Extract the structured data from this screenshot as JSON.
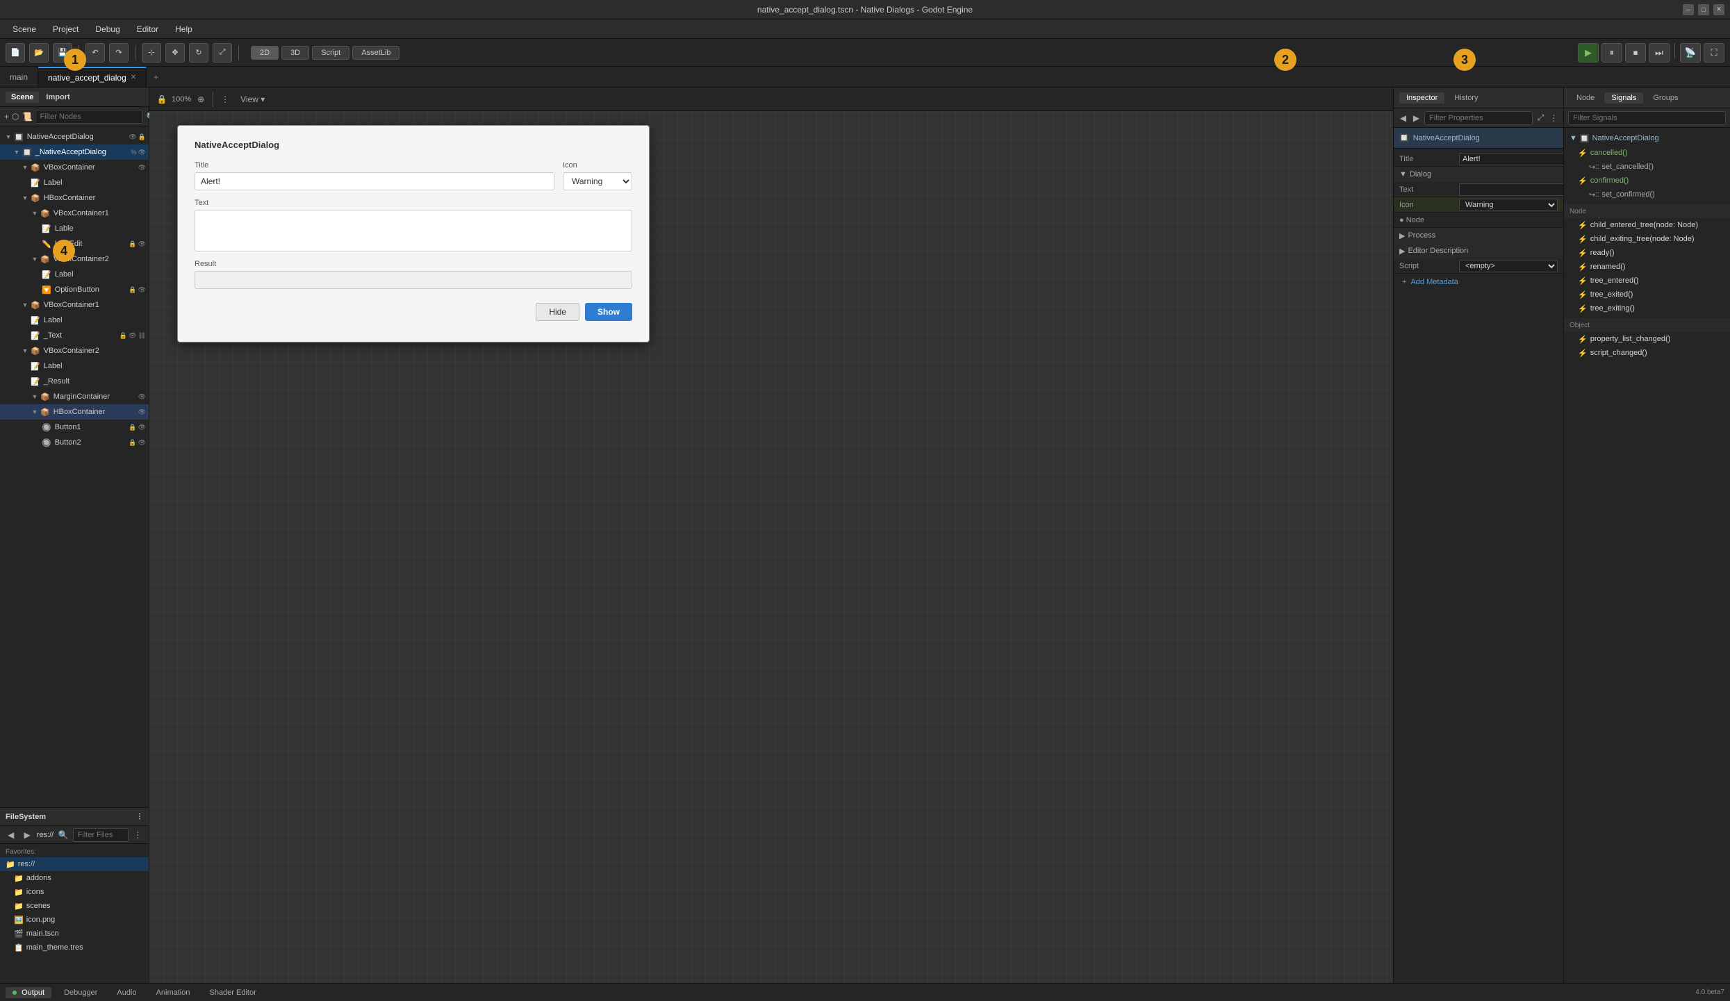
{
  "window": {
    "title": "native_accept_dialog.tscn - Native Dialogs - Godot Engine"
  },
  "menu": {
    "items": [
      "Scene",
      "Project",
      "Debug",
      "Editor",
      "Help"
    ]
  },
  "toolbar": {
    "view_modes": [
      "2D",
      "3D",
      "Script",
      "AssetLib"
    ],
    "active_view": "2D"
  },
  "tabs": {
    "items": [
      "main",
      "native_accept_dialog"
    ],
    "active": "native_accept_dialog",
    "add_label": "+"
  },
  "scene_panel": {
    "title": "Scene",
    "import_tab": "Import",
    "filter_placeholder": "Filter Nodes",
    "nodes": [
      {
        "level": 0,
        "label": "NativeAcceptDialog",
        "icon": "🔲",
        "has_children": true,
        "badges": [
          "eye",
          "lock"
        ]
      },
      {
        "level": 1,
        "label": "_NativeAcceptDialog",
        "icon": "🔲",
        "has_children": true,
        "selected": true,
        "badges": [
          "percent",
          "eye"
        ]
      },
      {
        "level": 2,
        "label": "VBoxContainer",
        "icon": "📦",
        "has_children": true,
        "badges": [
          "eye"
        ]
      },
      {
        "level": 3,
        "label": "Label",
        "icon": "📝",
        "has_children": false
      },
      {
        "level": 2,
        "label": "HBoxContainer",
        "icon": "📦",
        "has_children": true
      },
      {
        "level": 3,
        "label": "VBoxContainer1",
        "icon": "📦",
        "has_children": true
      },
      {
        "level": 4,
        "label": "Lable",
        "icon": "📝"
      },
      {
        "level": 4,
        "label": "LineEdit",
        "icon": "✏️",
        "badges": [
          "lock",
          "eye"
        ]
      },
      {
        "level": 3,
        "label": "VBoxContainer2",
        "icon": "📦",
        "has_children": true
      },
      {
        "level": 4,
        "label": "Label",
        "icon": "📝"
      },
      {
        "level": 4,
        "label": "OptionButton",
        "icon": "🔽",
        "badges": [
          "lock",
          "eye"
        ]
      },
      {
        "level": 2,
        "label": "VBoxContainer1",
        "icon": "📦",
        "has_children": true
      },
      {
        "level": 3,
        "label": "Label",
        "icon": "📝"
      },
      {
        "level": 3,
        "label": "_Text",
        "icon": "📝",
        "badges": [
          "lock",
          "eye",
          "chain"
        ]
      },
      {
        "level": 2,
        "label": "VBoxContainer2",
        "icon": "📦",
        "has_children": true
      },
      {
        "level": 3,
        "label": "Label",
        "icon": "📝"
      },
      {
        "level": 3,
        "label": "_Result",
        "icon": "📝"
      },
      {
        "level": 3,
        "label": "MarginContainer",
        "icon": "📦",
        "has_children": true,
        "badges": [
          "eye"
        ]
      },
      {
        "level": 3,
        "label": "HBoxContainer",
        "icon": "📦",
        "has_children": true,
        "selected_parent": true,
        "badges": [
          "eye"
        ]
      },
      {
        "level": 4,
        "label": "Button1",
        "icon": "🔘",
        "badges": [
          "lock",
          "eye"
        ]
      },
      {
        "level": 4,
        "label": "Button2",
        "icon": "🔘",
        "badges": [
          "lock",
          "eye"
        ]
      }
    ]
  },
  "filesystem": {
    "title": "FileSystem",
    "path": "res://",
    "filter_placeholder": "Filter Files",
    "favorites_label": "Favorites:",
    "items": [
      {
        "label": "res://",
        "icon": "folder",
        "level": 0,
        "selected": true
      },
      {
        "label": "addons",
        "icon": "folder",
        "level": 1
      },
      {
        "label": "icons",
        "icon": "folder",
        "level": 1
      },
      {
        "label": "scenes",
        "icon": "folder",
        "level": 1
      },
      {
        "label": "icon.png",
        "icon": "image",
        "level": 1
      },
      {
        "label": "main.tscn",
        "icon": "scene",
        "level": 1
      },
      {
        "label": "main_theme.tres",
        "icon": "resource",
        "level": 1
      }
    ]
  },
  "canvas": {
    "zoom": "100%",
    "dialog": {
      "title": "NativeAcceptDialog",
      "title_label": "Title",
      "title_value": "Alert!",
      "icon_label": "Icon",
      "icon_value": "Warning",
      "text_label": "Text",
      "result_label": "Result",
      "hide_btn": "Hide",
      "show_btn": "Show"
    }
  },
  "inspector": {
    "tab_inspector": "Inspector",
    "tab_history": "History",
    "filter_placeholder": "Filter Properties",
    "node_name": "NativeAcceptDialog",
    "sections": {
      "node_header": "NativeAcceptDialog",
      "title_label": "Title",
      "title_value": "Alert!",
      "dialog_label": "Dialog",
      "text_label": "Text",
      "icon_label": "Icon",
      "icon_value": "Warning",
      "process_label": "Process",
      "editor_desc_label": "Editor Description",
      "script_label": "Script",
      "script_value": "<empty>",
      "add_metadata_label": "Add Metadata"
    }
  },
  "signals": {
    "tab_node": "Node",
    "tab_signals": "Signals",
    "tab_groups": "Groups",
    "filter_placeholder": "Filter Signals",
    "node_name": "NativeAcceptDialog",
    "items": [
      {
        "label": "cancelled()",
        "type": "signal"
      },
      {
        "label": ":: set_cancelled()",
        "type": "method",
        "sub": true
      },
      {
        "label": "confirmed()",
        "type": "signal"
      },
      {
        "label": ":: set_confirmed()",
        "type": "method",
        "sub": true
      }
    ],
    "sections": [
      {
        "label": "child_entered_tree(node: Node)",
        "type": "signal"
      },
      {
        "label": "child_exiting_tree(node: Node)",
        "type": "signal"
      },
      {
        "label": "ready()",
        "type": "signal"
      },
      {
        "label": "renamed()",
        "type": "signal"
      },
      {
        "label": "tree_entered()",
        "type": "signal"
      },
      {
        "label": "tree_exited()",
        "type": "signal"
      },
      {
        "label": "tree_exiting()",
        "type": "signal"
      }
    ],
    "object_section": [
      {
        "label": "property_list_changed()",
        "type": "signal"
      },
      {
        "label": "script_changed()",
        "type": "signal"
      }
    ]
  },
  "bottom_bar": {
    "output_label": "Output",
    "debugger_label": "Debugger",
    "audio_label": "Audio",
    "animation_label": "Animation",
    "shader_label": "Shader Editor",
    "version": "4.0.beta7"
  },
  "numbers": {
    "scene": "1",
    "inspector": "2",
    "signals": "3",
    "result": "4"
  },
  "colors": {
    "accent": "#3399ff",
    "warning": "#e8a020",
    "play": "#5cb85c",
    "selected_bg": "#1a3a5c"
  }
}
